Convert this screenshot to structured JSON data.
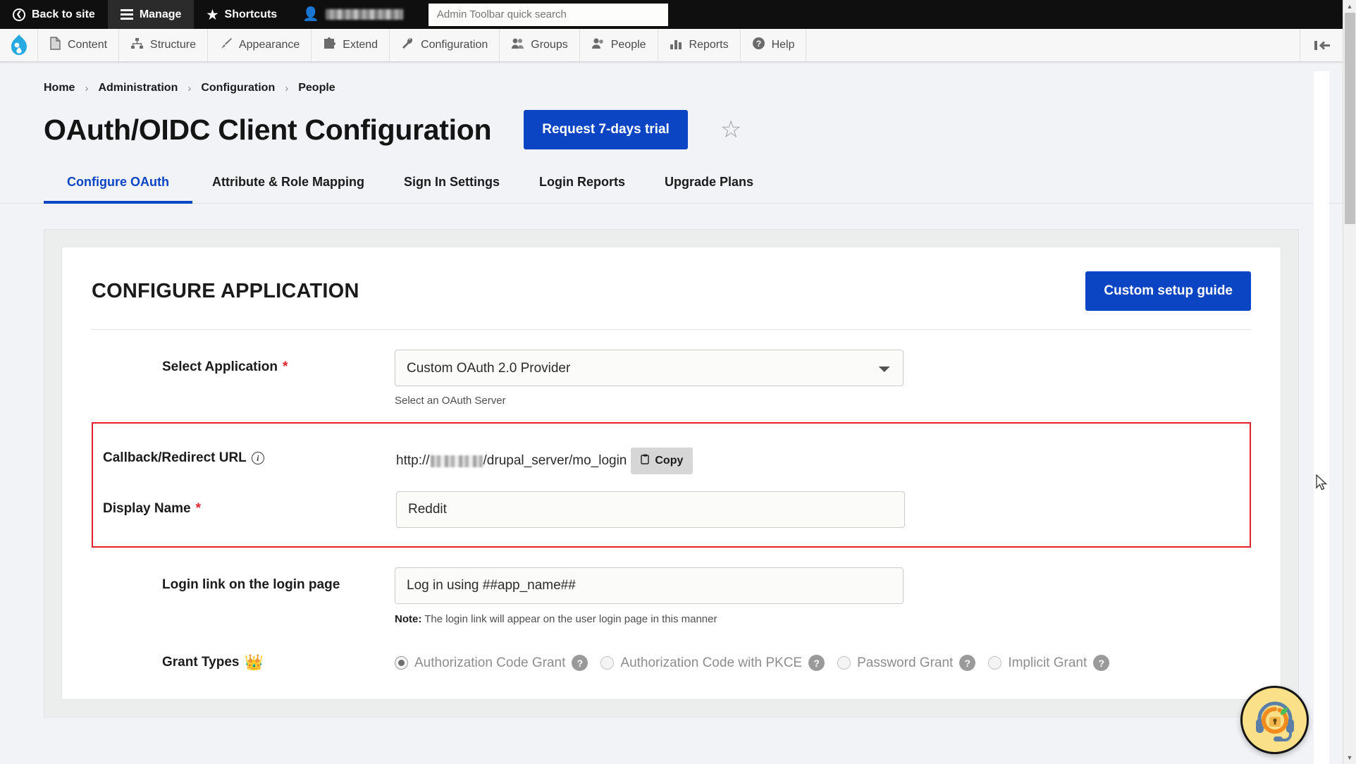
{
  "admin_toolbar": {
    "back_to_site": "Back to site",
    "manage": "Manage",
    "shortcuts": "Shortcuts",
    "username_redacted": "",
    "search_placeholder": "Admin Toolbar quick search"
  },
  "menu_bar": {
    "logo": "drupal-drop-icon",
    "items": [
      {
        "label": "Content",
        "icon": "document-icon"
      },
      {
        "label": "Structure",
        "icon": "sitemap-icon"
      },
      {
        "label": "Appearance",
        "icon": "paintbrush-icon"
      },
      {
        "label": "Extend",
        "icon": "puzzle-icon"
      },
      {
        "label": "Configuration",
        "icon": "wrench-icon"
      },
      {
        "label": "Groups",
        "icon": "people-icon"
      },
      {
        "label": "People",
        "icon": "users-icon"
      },
      {
        "label": "Reports",
        "icon": "bar-chart-icon"
      },
      {
        "label": "Help",
        "icon": "question-circle-icon"
      }
    ],
    "collapse": "collapse-toolbar-icon"
  },
  "breadcrumb": [
    "Home",
    "Administration",
    "Configuration",
    "People"
  ],
  "header": {
    "title": "OAuth/OIDC Client Configuration",
    "trial_button": "Request 7-days trial",
    "favorite_icon": "star-outline-icon"
  },
  "tabs": [
    {
      "label": "Configure OAuth",
      "active": true
    },
    {
      "label": "Attribute & Role Mapping",
      "active": false
    },
    {
      "label": "Sign In Settings",
      "active": false
    },
    {
      "label": "Login Reports",
      "active": false
    },
    {
      "label": "Upgrade Plans",
      "active": false
    }
  ],
  "card": {
    "heading": "CONFIGURE APPLICATION",
    "setup_guide_button": "Custom setup guide",
    "select_application": {
      "label": "Select Application",
      "required": "*",
      "value": "Custom OAuth 2.0 Provider",
      "options": [
        "Custom OAuth 2.0 Provider"
      ],
      "helper": "Select an OAuth Server"
    },
    "callback_url": {
      "label": "Callback/Redirect URL",
      "info_icon": "info-circle-icon",
      "url_prefix": "http://",
      "url_suffix": "/drupal_server/mo_login",
      "copy_button": "Copy",
      "copy_icon": "clipboard-icon"
    },
    "display_name": {
      "label": "Display Name",
      "required": "*",
      "value": "Reddit"
    },
    "login_link": {
      "label": "Login link on the login page",
      "value": "Log in using ##app_name##",
      "note_prefix": "Note:",
      "note_text": "The login link will appear on the user login page in this manner"
    },
    "grant_types": {
      "label": "Grant Types",
      "premium_icon": "crown-icon",
      "options": [
        {
          "label": "Authorization Code Grant",
          "selected": true,
          "help": "?"
        },
        {
          "label": "Authorization Code with PKCE",
          "selected": false,
          "help": "?"
        },
        {
          "label": "Password Grant",
          "selected": false,
          "help": "?"
        },
        {
          "label": "Implicit Grant",
          "selected": false,
          "help": "?"
        }
      ]
    }
  },
  "support_widget": {
    "icon": "headset-lock-support-icon"
  },
  "colors": {
    "brand_blue": "#0b45c4",
    "highlight_red": "#e1212c",
    "drupal_cyan": "#25a9e0"
  }
}
